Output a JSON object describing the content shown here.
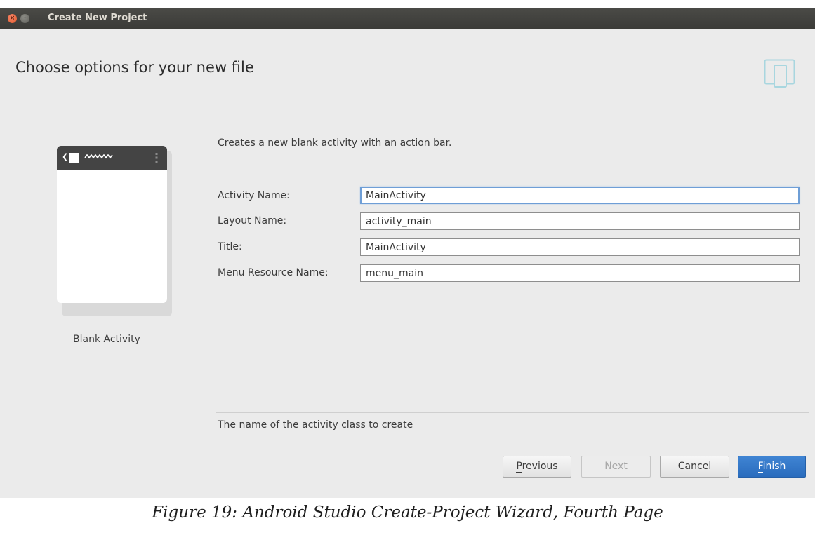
{
  "window": {
    "title": "Create New Project"
  },
  "page": {
    "heading": "Choose options for your new file",
    "description": "Creates a new blank activity with an action bar."
  },
  "template": {
    "label": "Blank Activity"
  },
  "form": {
    "fields": [
      {
        "label": "Activity Name:",
        "value": "MainActivity",
        "focused": true
      },
      {
        "label": "Layout Name:",
        "value": "activity_main",
        "focused": false
      },
      {
        "label": "Title:",
        "value": "MainActivity",
        "focused": false
      },
      {
        "label": "Menu Resource Name:",
        "value": "menu_main",
        "focused": false
      }
    ]
  },
  "status": {
    "text": "The name of the activity class to create"
  },
  "buttons": {
    "previous": {
      "first": "P",
      "rest": "revious"
    },
    "next": {
      "label": "Next",
      "enabled": false
    },
    "cancel": {
      "label": "Cancel"
    },
    "finish": {
      "first": "F",
      "rest": "inish"
    }
  },
  "caption": "Figure 19: Android Studio Create-Project Wizard, Fourth Page",
  "colors": {
    "accent": "#2d6fbf",
    "focus_border": "#6e9ed6",
    "titlebar": "#3c3b37",
    "close_button": "#e25a2b"
  },
  "icons": {
    "titlebar_close": "close-icon",
    "titlebar_minimize": "minimize-icon",
    "header": "tablet-phone-icon"
  }
}
